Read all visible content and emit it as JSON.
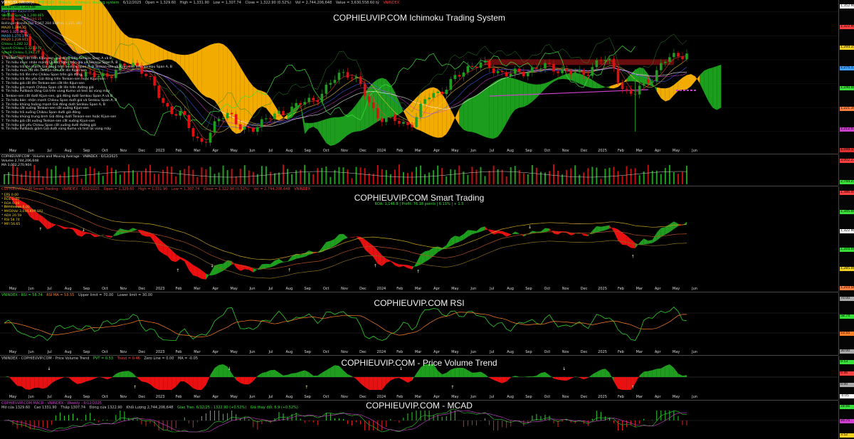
{
  "window_title": "VNINDEX (Weekly)",
  "months": [
    "May",
    "Jun",
    "Jul",
    "Aug",
    "Sep",
    "Oct",
    "Nov",
    "Dec",
    "2023",
    "Feb",
    "Mar",
    "Apr",
    "May",
    "Jun",
    "Jul",
    "Aug",
    "Sep",
    "Oct",
    "Nov",
    "Dec",
    "2024",
    "Feb",
    "Mar",
    "Apr",
    "May",
    "Jun",
    "Jul",
    "Aug",
    "Sep",
    "Oct",
    "Nov",
    "Dec",
    "2025",
    "Feb",
    "Mar",
    "Apr",
    "May",
    "Jun"
  ],
  "colors": {
    "up": "#1f9d1f",
    "down": "#e01010",
    "kumo_green": "#1fa51f",
    "kumo_orange": "#ffb400",
    "yellow": "#f0d020",
    "magenta": "#d040d0"
  },
  "panes": {
    "ichimoku": {
      "title": "COPHIEUVIP.COM Ichimoku Trading System",
      "header": [
        "VNINDEX - Weekly",
        "Ichimoku trading system",
        "6/12/2025",
        "Open = 1,329.60",
        "High = 1,331.90",
        "Low = 1,307.74",
        "Close = 1,322.90 (0.52%)",
        "Vol = 2,744,206,648",
        "Value = 3,630,558.60 tỷ",
        "VNINDEX"
      ],
      "legend_top": [
        "Tenkan-sen 1,324.88",
        "Kijun-sen 1,212.075",
        "Senkou Span A 1,240.465",
        "Senkou Span B 1,194.15",
        "Bollinger Bands Top 1,367.284 Bottom 1,221.393",
        "MA20 1,294.35",
        "MA5 1,320.285",
        "MA10 1,275.174",
        "MA20 1,239.911",
        "Chikou 1,282.12",
        "SpanA Chikou 1,221.472",
        "SpanB Chikou 1,192.27",
        "TÍN HIỆU TRUNG HẠN"
      ],
      "legend_a": [
        "1. Tenkan-sen cắt trên Kijun-sen, giá đóng trên Senkou Span A và B",
        "2. Tín hiệu mua: nhận mạnh   Chikou Span trên giá và Senkou Span A, B",
        "3. Tín hiệu trả lên mạnh   Giá đóng trên Senkou Span A, B  Tenkan-sen và Kijun-sen trên Senkou Span A, B",
        "4. Tín hiệu mua cắt lên   Tenkan-sen cắt lên Kijun-sen",
        "5. Tín hiệu trả lên nhẹ   Chikou Span trên giá đóng",
        "6. Tín hiệu trả lên yếu   Giá đóng trên Tenkan-sen hoặc Kijun-sen",
        "7. Tín hiệu giá cắt lên   Tenkan-sen cắt lên Kijun-sen",
        "8. Tín hiệu giá mạnh   Chikou Span cắt lên trên đường giá",
        "9. Tín hiệu Pullback tăng   Giá trên vùng Kumo và test lại vùng mây"
      ],
      "legend_b": [
        "1. Tenkan-sen cắt dưới Kijun-sen, giá đóng dưới Senkou Span A và B",
        "2. Tín hiệu bán: nhận mạnh   Chikou Span dưới giá và Senkou Span A, B",
        "3. Tín hiệu khủng hoảng mạnh   Giá đóng dưới Senkou Span A, B",
        "4. Tín hiệu cắt xuống   Tenkan-sen cắt xuống Kijun-sen",
        "5. Tín hiệu trả xuống   Chikou Span dưới giá đóng",
        "6. Tín hiệu khủng trung bình   Giá đóng dưới Tenkan-sen hoặc Kijun-sen",
        "7. Tín hiệu giá cắt xuống   Tenkan-sen cắt xuống Kijun-sen",
        "8. Tín hiệu giá yếu   Chikou Span cắt xuống dưới đường giá",
        "9. Tín hiệu Pullback giảm   Giá dưới vùng Kumo và test lại vùng mây"
      ],
      "scale": [
        "1,352.90",
        "1,322.90",
        "1,294.35",
        "1,275.17",
        "1,240.46",
        "1,221.39",
        "1,212.07",
        "1,194.15"
      ]
    },
    "volume": {
      "header": [
        "COPHIEUVIP.COM - Volume and Moving Average - VNINDEX - 6/12/2025",
        "Volume 2,744,206,648",
        "MA 3,002,270,904"
      ],
      "scale": [
        "3,002.27",
        "2,744.21"
      ]
    },
    "smart": {
      "title": "COPHIEUVIP.COM Smart Trading",
      "header": [
        "COPHIEUVIP.COM Smart Trading - VNINDEX - 6/12/2025",
        "Open = 1,329.60",
        "High = 1,331.90",
        "Low = 1,307.74",
        "Close = 1,322.90 (0.52%)",
        "Vol = 2,744,206,648",
        "VNINDEX"
      ],
      "subheader": "ROA: 1,146.8 | Profit: 76.18 points | 6.11% | + 1.5",
      "legend": [
        "* EPS    0.00",
        "* ROE    0.00",
        "* ROA    0.00",
        "* Bondvalue    0.00",
        "* MA50Vol    3,044,809,192",
        "* ADX    20.59",
        "* RSI    58.74",
        "* MFI    56.65"
      ],
      "scale": [
        "1,386.40",
        "1,345.00",
        "1,322.90",
        "1,310.00",
        "1,285.00",
        "1,210.56"
      ]
    },
    "rsi": {
      "title": "COPHIEUVIP.COM RSI",
      "header": [
        "VNINDEX - RSI = 58.74",
        "RSI MA = 53.55",
        "Upper limit = 70.00",
        "Lower limit = 30.00"
      ],
      "scale": [
        "70.00",
        "58.74",
        "53.55",
        "30.00"
      ]
    },
    "pvt": {
      "title": "COPHIEUVIP.COM - Price Volume Trend",
      "header": [
        "VNINDEX - COPHIEUVIP.COM - Price Volume Trend",
        "PVT = 0.53",
        "Trend = 0.46",
        "Zero Line = 0.00",
        "MA = -0.05"
      ],
      "scale": [
        "0.53",
        "0.46",
        "0.00",
        "-0.05"
      ]
    },
    "macd": {
      "title": "COPHIEUVIP.COM - MCAD",
      "header": [
        "COPHIEUVIP.COM MACD - VNINDEX - Weekly - 6/12/2025",
        "Mở cửa 1329.60",
        "Cao 1331.90",
        "Thấp 1307.74",
        "Đóng cửa 1322.90",
        "Khối Lượng 2,744,206,648",
        "Giao Trao: 6/12/25 - 1322.90 (+0.52%)",
        "Giá thay đổi: 6.9 (+0.52%)"
      ],
      "scale": [
        "18.66",
        "10.75",
        "3.52"
      ]
    }
  }
}
